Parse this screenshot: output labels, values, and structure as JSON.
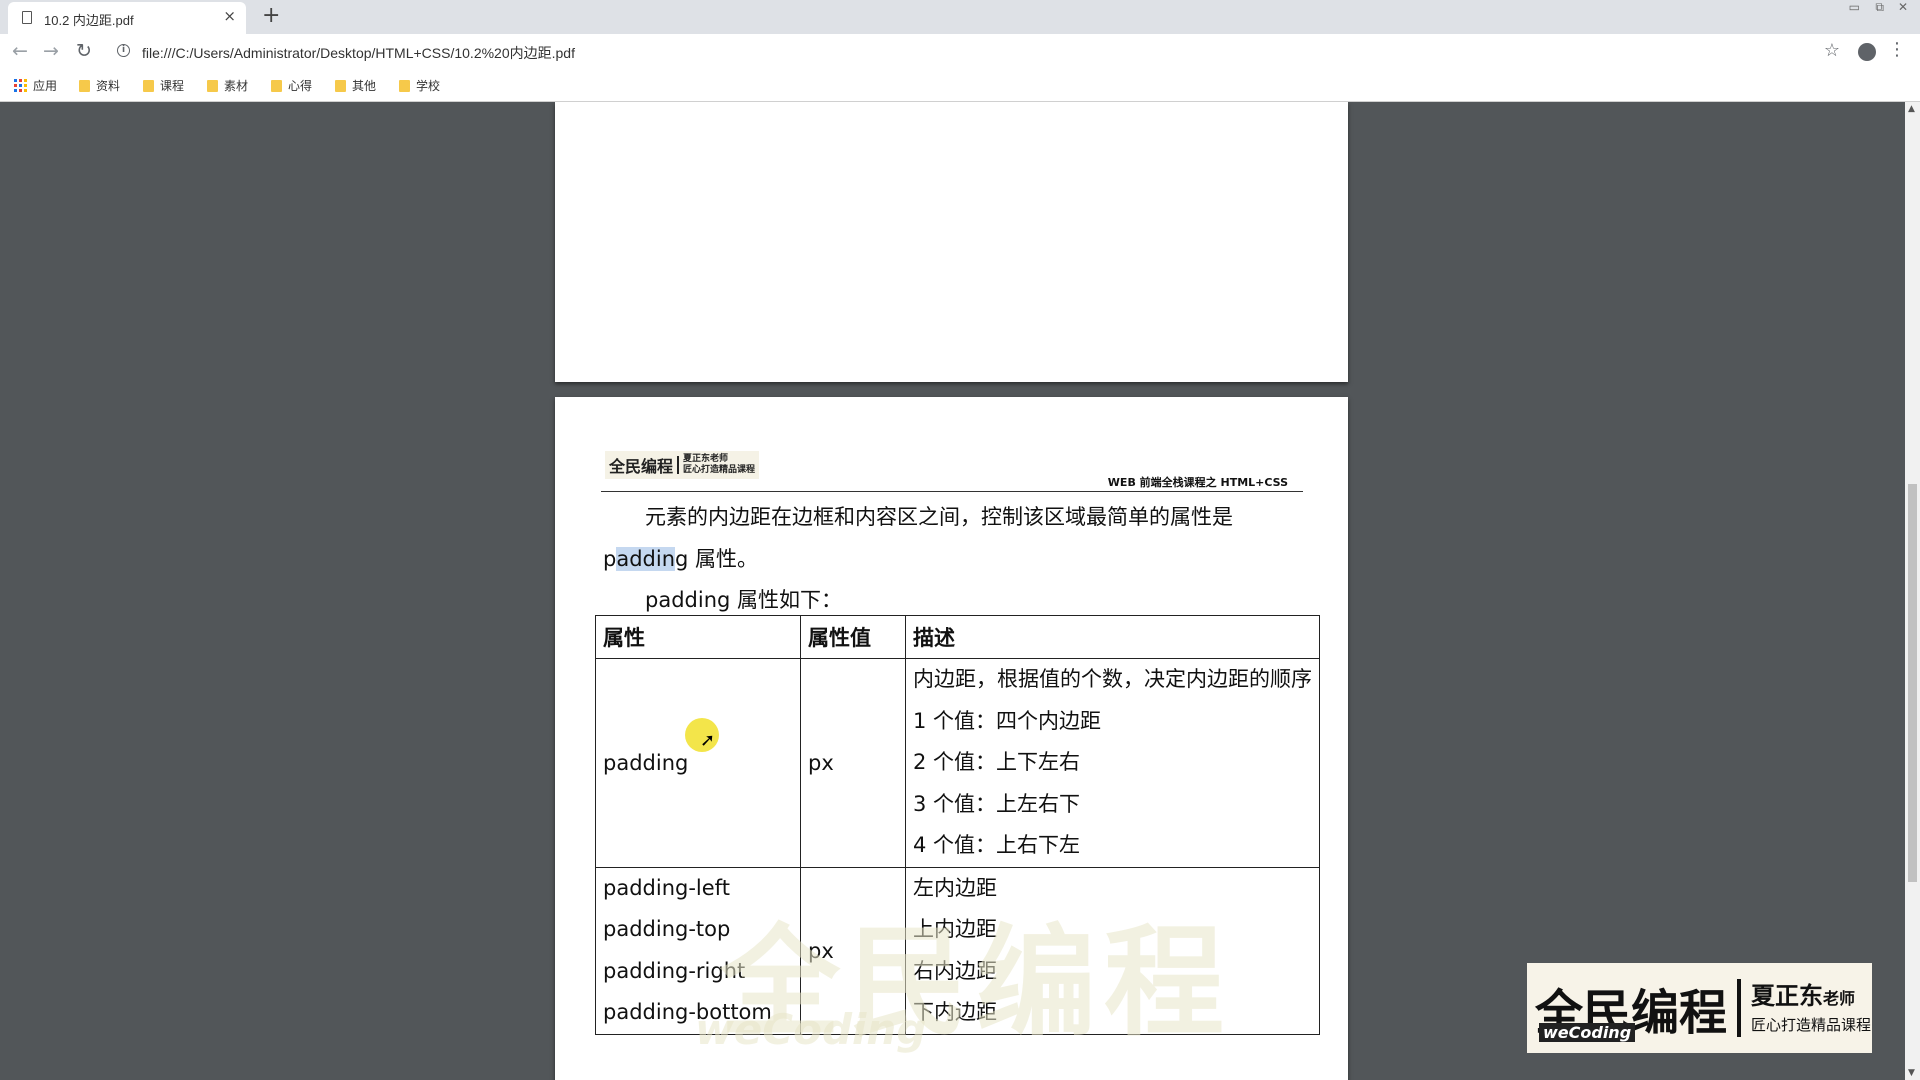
{
  "tab": {
    "title": "10.2 内边距.pdf",
    "close": "×",
    "new_tab": "+"
  },
  "window": {
    "minimize": "▭",
    "restore": "⧉",
    "close": "✕"
  },
  "toolbar": {
    "back": "←",
    "forward": "→",
    "reload": "↻",
    "url": "file:///C:/Users/Administrator/Desktop/HTML+CSS/10.2%20内边距.pdf",
    "star": "☆",
    "menu": "⋮"
  },
  "bookmarks": [
    {
      "label": "应用",
      "icon": "apps-icon"
    },
    {
      "label": "资料",
      "icon": "folder-icon"
    },
    {
      "label": "课程",
      "icon": "folder-icon"
    },
    {
      "label": "素材",
      "icon": "folder-icon"
    },
    {
      "label": "心得",
      "icon": "folder-icon"
    },
    {
      "label": "其他",
      "icon": "folder-icon"
    },
    {
      "label": "学校",
      "icon": "folder-icon"
    }
  ],
  "doc": {
    "header_logo": "全民编程",
    "header_teacher": "夏正东老师",
    "header_slogan": "匠心打造精品课程",
    "header_right": "WEB 前端全栈课程之 HTML+CSS",
    "para1_a": "元素的内边距在边框和内容区之间，控制该区域最简单的属性是",
    "para1_b1": "p",
    "para1_b_hl": "addin",
    "para1_b2": "g 属性。",
    "para2": "padding 属性如下：",
    "table": {
      "headers": [
        "属性",
        "属性值",
        "描述"
      ],
      "row1": {
        "prop": "padding",
        "value": "px",
        "desc": [
          "内边距，根据值的个数，决定内边距的顺序",
          "1 个值：四个内边距",
          "2 个值：上下左右",
          "3 个值：上左右下",
          "4 个值：上右下左"
        ]
      },
      "row2": {
        "props": [
          "padding-left",
          "padding-top",
          "padding-right",
          "padding-bottom"
        ],
        "value": "px",
        "desc": [
          "左内边距",
          "上内边距",
          "右内边距",
          "下内边距"
        ]
      }
    },
    "watermark": "全民编程",
    "watermark_sub": "weCoding"
  },
  "corner_logo": {
    "main": "全民编程",
    "sub": "weCoding",
    "teacher": "夏正东",
    "title": "老师",
    "slogan": "匠心打造精品课程"
  },
  "colors": {
    "viewer_bg": "#525659",
    "highlight": "#c5d8f0",
    "cursor_highlight": "#f1e02a"
  }
}
